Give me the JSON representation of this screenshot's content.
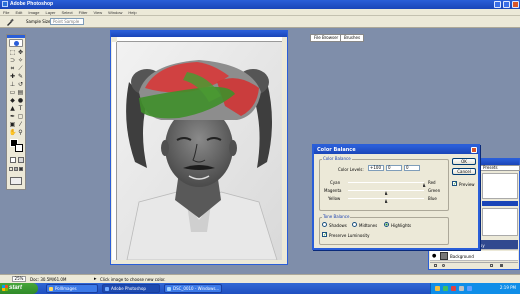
{
  "window": {
    "title": "Adobe Photoshop"
  },
  "menu": [
    "File",
    "Edit",
    "Image",
    "Layer",
    "Select",
    "Filter",
    "View",
    "Window",
    "Help"
  ],
  "options": {
    "sample_size_label": "Sample Size:",
    "sample_size_value": "Point Sample"
  },
  "palette_well": {
    "file_browser": "File Browser",
    "brushes": "Brushes"
  },
  "dialog": {
    "title": "Color Balance",
    "color_balance_group": "Color Balance",
    "color_levels_label": "Color Levels:",
    "levels": [
      "+100",
      "0",
      "0"
    ],
    "sliders": [
      {
        "left": "Cyan",
        "right": "Red",
        "value": 100
      },
      {
        "left": "Magenta",
        "right": "Green",
        "value": 0
      },
      {
        "left": "Yellow",
        "right": "Blue",
        "value": 0
      }
    ],
    "tone_balance_group": "Tone Balance",
    "tones": [
      {
        "label": "Shadows",
        "selected": false
      },
      {
        "label": "Midtones",
        "selected": false
      },
      {
        "label": "Highlights",
        "selected": true
      }
    ],
    "preserve_luminosity": "Preserve Luminosity",
    "preserve_luminosity_checked": true,
    "ok_label": "OK",
    "cancel_label": "Cancel",
    "preview_label": "Preview",
    "preview_checked": true
  },
  "layers": {
    "rows": [
      {
        "name": "Background copy",
        "selected": true
      },
      {
        "name": "Background",
        "selected": false
      }
    ],
    "strip_labels": [
      "Presets"
    ]
  },
  "status": {
    "zoom": "25%",
    "doc": "Doc: 30.5M/61.0M",
    "hint": "Click image to choose new color."
  },
  "taskbar": {
    "start": "start",
    "tasks": [
      "PollImages",
      "Adobe Photoshop",
      "DSC_0010 - Windows..."
    ],
    "clock": "2:19 PM"
  },
  "colors": {
    "turban_red": "#d63b3b",
    "turban_green": "#3f8f2a",
    "xp_blue": "#2a5ed8"
  }
}
